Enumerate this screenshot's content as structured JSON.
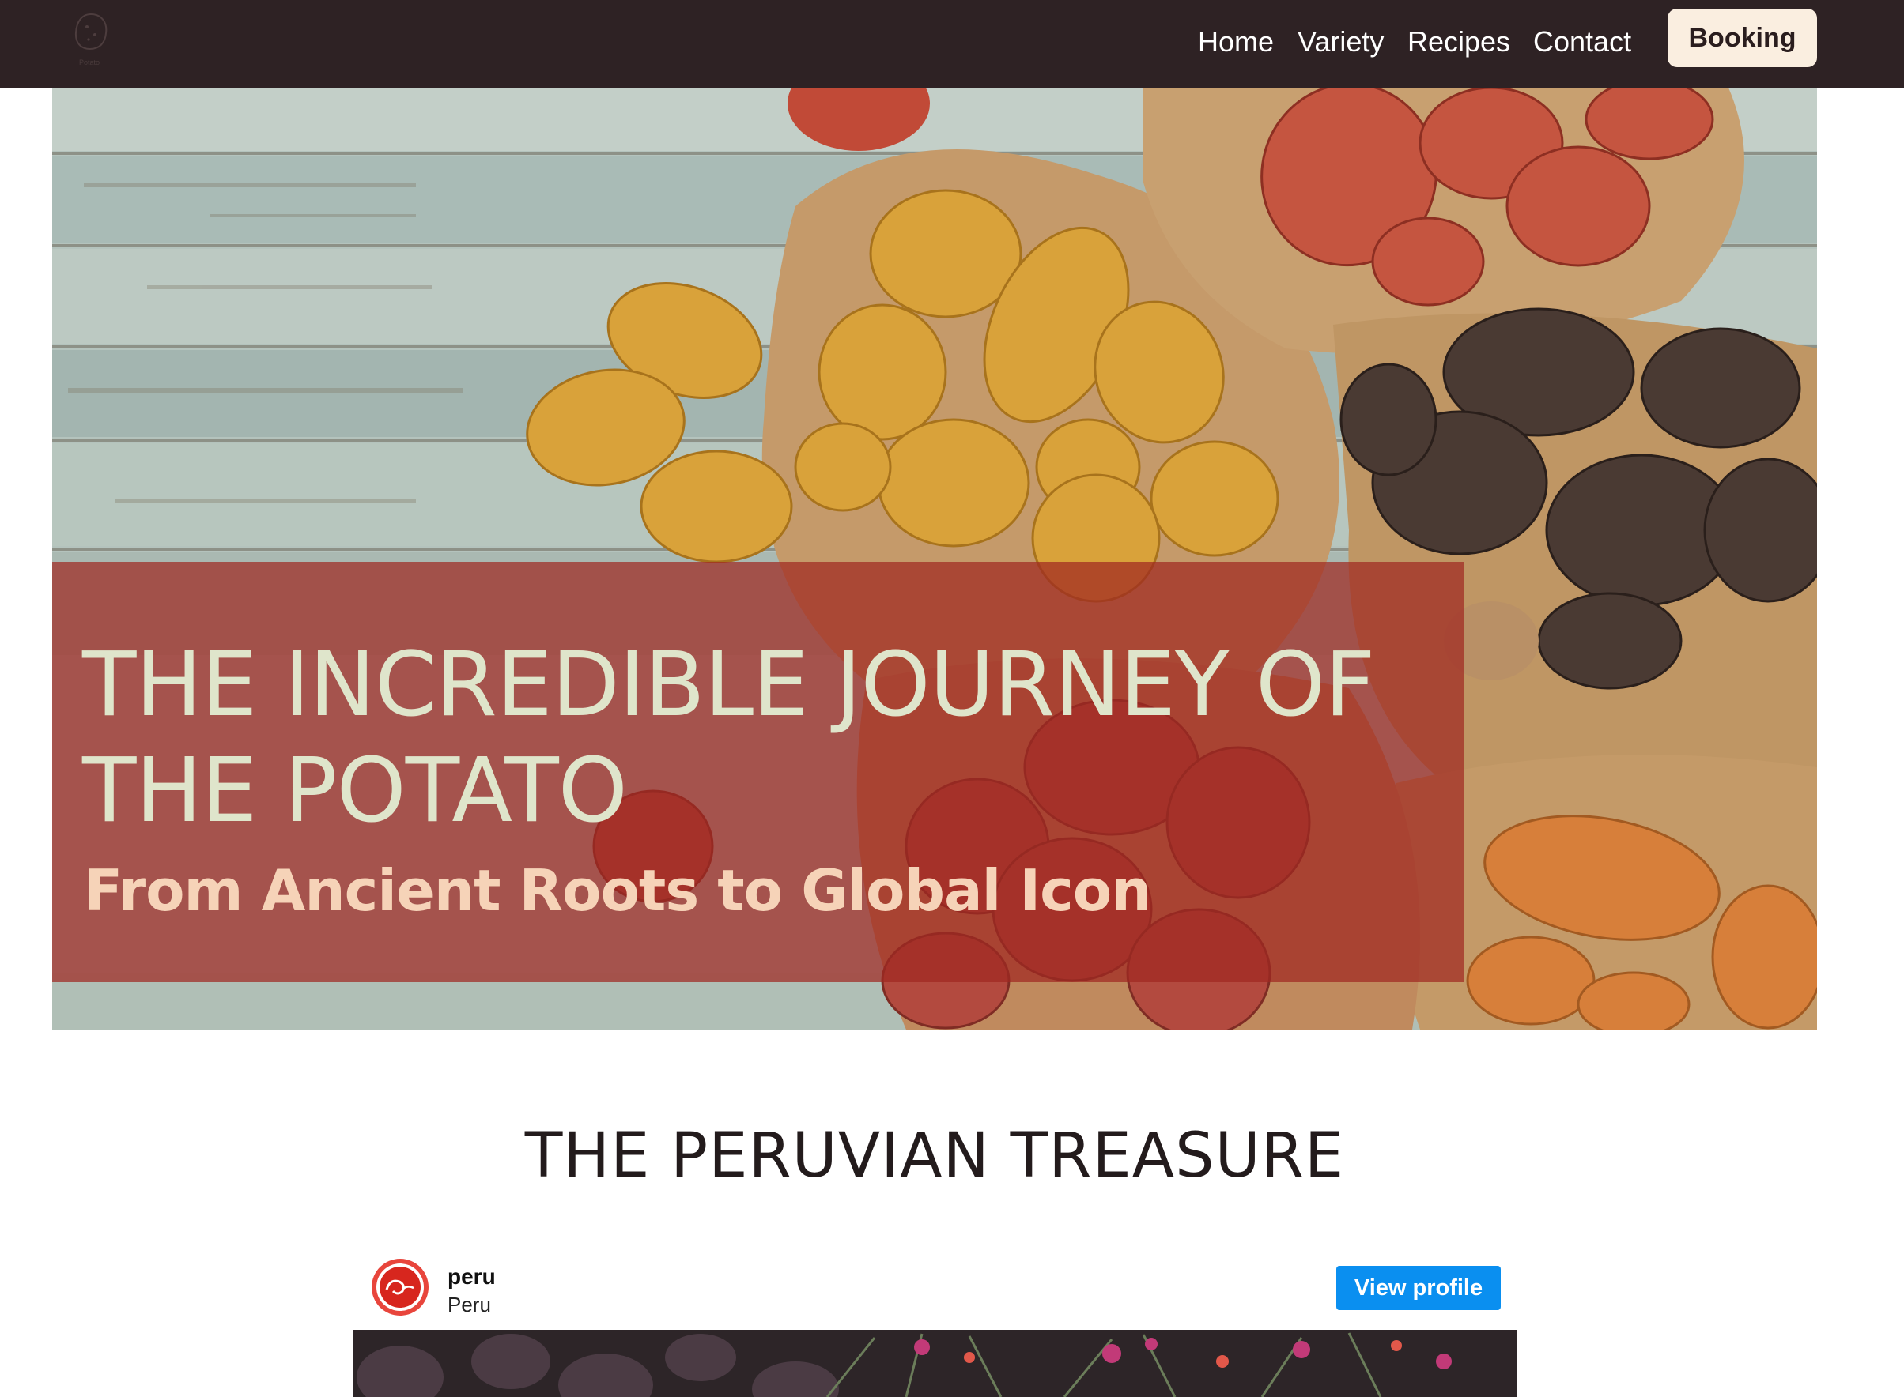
{
  "nav": {
    "logo_icon": "potato-logo-icon",
    "logo_caption": "Potato",
    "links": [
      {
        "label": "Home"
      },
      {
        "label": "Variety"
      },
      {
        "label": "Recipes"
      },
      {
        "label": "Contact"
      }
    ],
    "booking_label": "Booking"
  },
  "hero": {
    "title": "THE INCREDIBLE JOURNEY OF THE POTATO",
    "subtitle": "From Ancient Roots to Global Icon"
  },
  "section": {
    "title": "THE PERUVIAN TREASURE"
  },
  "embed": {
    "username": "peru",
    "location": "Peru",
    "view_profile_label": "View profile",
    "avatar_icon": "peru-brand-avatar-icon"
  },
  "colors": {
    "nav_bg": "#2e2224",
    "booking_bg": "#faeee0",
    "banner_overlay": "#9f2821",
    "hero_title": "#dfe5cb",
    "hero_subtitle": "#f6d3b8",
    "view_profile_bg": "#0a8ff0"
  }
}
